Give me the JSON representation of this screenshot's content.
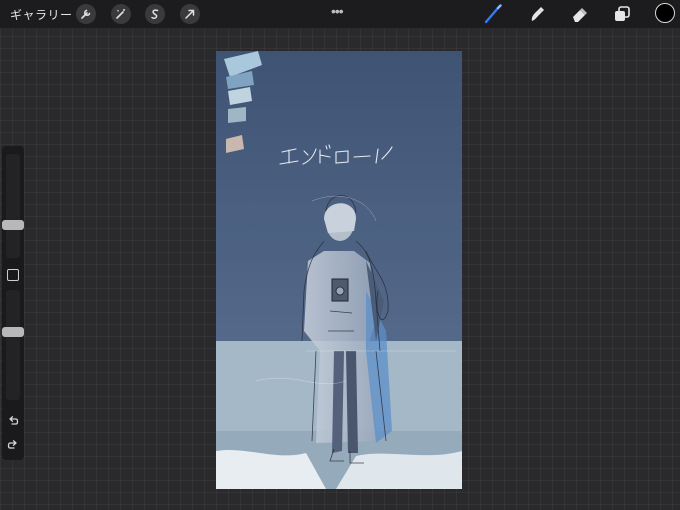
{
  "topbar": {
    "gallery_label": "ギャラリー",
    "tools": [
      {
        "icon": "wrench-icon"
      },
      {
        "icon": "magic-wand-icon"
      },
      {
        "icon": "selection-s-icon"
      },
      {
        "icon": "transform-arrow-icon"
      }
    ],
    "more_glyph": "•••",
    "right_tools": [
      {
        "icon": "brush-icon",
        "color": "#2f7df6"
      },
      {
        "icon": "smudge-icon"
      },
      {
        "icon": "eraser-icon"
      },
      {
        "icon": "layers-icon"
      }
    ],
    "current_color": "#000000"
  },
  "sidebar": {
    "brush_size_level": 0.3,
    "opacity_level": 0.63
  },
  "canvas": {
    "handwritten_text": "エンドロール",
    "sky_color": "#445876",
    "ground_color": "#a4b8c8"
  }
}
